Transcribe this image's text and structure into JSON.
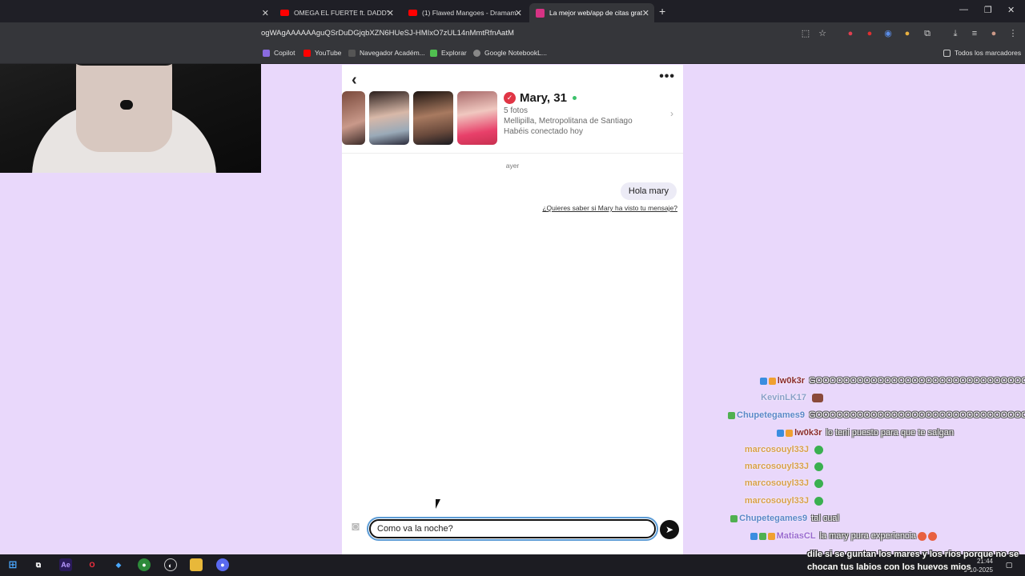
{
  "browser": {
    "tabs": [
      {
        "label": "OMEGA EL FUERTE ft. DADDY Y",
        "icon": "youtube-icon"
      },
      {
        "label": "(1) Flawed Mangoes - Dramam",
        "icon": "youtube-icon"
      },
      {
        "label": "La mejor web/app de citas grat",
        "icon": "site-icon"
      }
    ],
    "url": "ogWAgAAAAAAguQSrDuDGjqbXZN6HUeSJ-HMIxO7zUL14nMmtRfnAatM",
    "bookmarks": [
      "Copilot",
      "YouTube",
      "Navegador Académ...",
      "Explorar",
      "Google NotebookL..."
    ],
    "bookmarks_all": "Todos los marcadores"
  },
  "chat": {
    "profile": {
      "name": "Mary, 31",
      "photos": "5 fotos",
      "location": "Mellipilla, Metropolitana de Santiago",
      "connected": "Habéis conectado hoy"
    },
    "day_label": "ayer",
    "messages": [
      {
        "text": "Hola mary",
        "from": "me"
      }
    ],
    "seen_link": "¿Quieres saber si Mary ha visto tu mensaje?",
    "input_value": "Como va la noche?"
  },
  "stream_chat": [
    {
      "user": "lw0k3r",
      "text": "GOOOOOOOOOOOOOOOOOOOOOOOOOOOOOOOOOO",
      "color": "#8a2b2b"
    },
    {
      "user": "KevinLK17",
      "text": "",
      "color": "#8aa0c8"
    },
    {
      "user": "Chupetegames9",
      "text": "GOOOOOOOOOOOOOOOOOOOOOOOOOOOOOOOOOO",
      "color": "#5b88c8"
    },
    {
      "user": "lw0k3r",
      "text": "lo teni puesto para que te salgan",
      "color": "#8a2b2b"
    },
    {
      "user": "marcosouyl33J",
      "text": "",
      "color": "#d8a04a"
    },
    {
      "user": "marcosouyl33J",
      "text": "",
      "color": "#d8a04a"
    },
    {
      "user": "marcosouyl33J",
      "text": "",
      "color": "#d8a04a"
    },
    {
      "user": "marcosouyl33J",
      "text": "",
      "color": "#d8a04a"
    },
    {
      "user": "Chupetegames9",
      "text": "tal cual",
      "color": "#5b88c8"
    },
    {
      "user": "MatiasCL",
      "text": "la mary pura experiencia",
      "color": "#9a6ad0"
    }
  ],
  "caption": "dile si se guntan los mares y los ríos porque no se chocan tus labios con los huevos mios",
  "taskbar": {
    "time": "21:44",
    "date": "9-10-2025",
    "lang": "ESP"
  }
}
